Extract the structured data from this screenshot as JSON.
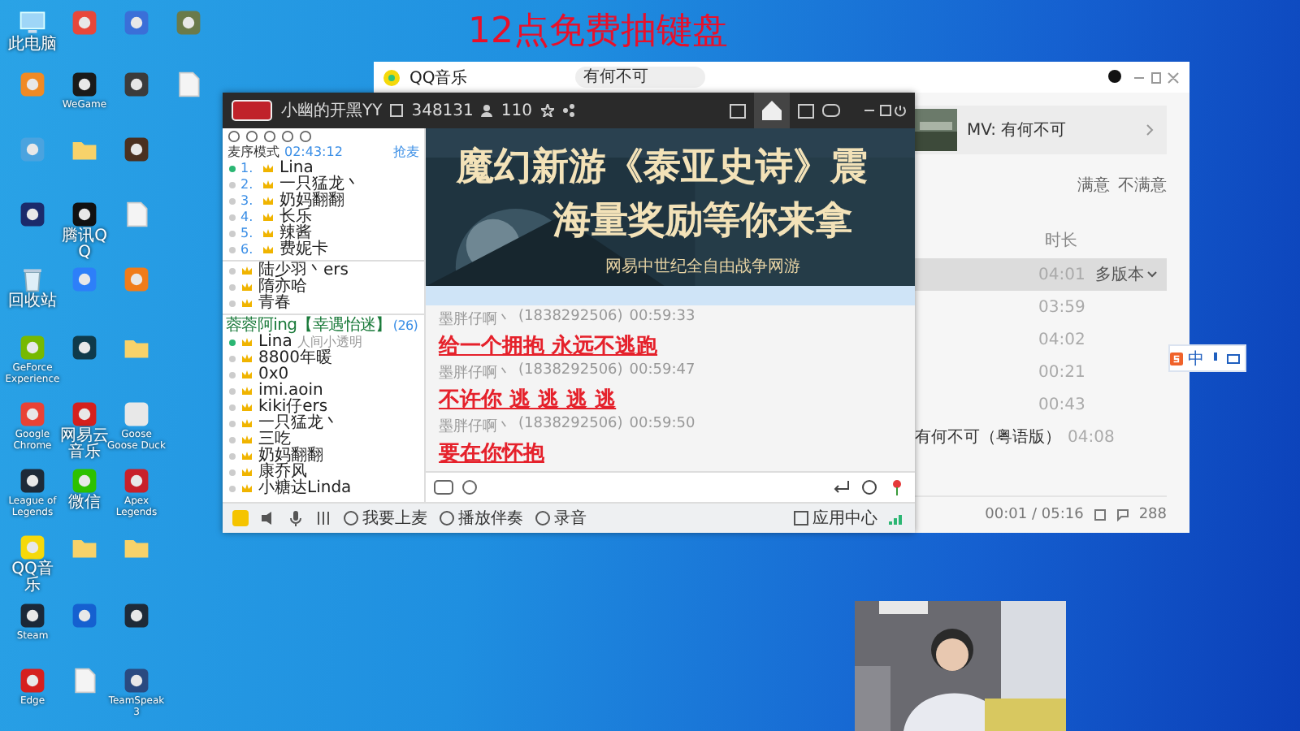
{
  "overlay_title": "12点免费抽键盘",
  "desktop_columns": [
    [
      {
        "kind": "pc",
        "label": "此电脑"
      },
      {
        "kind": "app",
        "color": "#f08a24"
      },
      {
        "kind": "app",
        "color": "#4aa3df"
      },
      {
        "kind": "app",
        "color": "#1b2a6b"
      },
      {
        "kind": "recycle",
        "label": "回收站"
      },
      {
        "kind": "app",
        "color": "#76b900",
        "label": "GeForce Experience"
      },
      {
        "kind": "app",
        "color": "#e94235",
        "label": "Google Chrome"
      },
      {
        "kind": "app",
        "color": "#1e2a38",
        "label": "League of Legends"
      },
      {
        "kind": "app",
        "color": "#f5d90a",
        "label": "QQ音乐"
      },
      {
        "kind": "app",
        "color": "#1b2838",
        "label": "Steam"
      },
      {
        "kind": "app",
        "color": "#d6201e",
        "label": "Edge"
      }
    ],
    [
      {
        "kind": "app",
        "color": "#e8473a"
      },
      {
        "kind": "app",
        "color": "#1a1a1a",
        "label": "WeGame"
      },
      {
        "kind": "folder"
      },
      {
        "kind": "app",
        "color": "#111111",
        "label": "腾讯QQ"
      },
      {
        "kind": "app",
        "color": "#2d7ff9"
      },
      {
        "kind": "app",
        "color": "#0f3a4a"
      },
      {
        "kind": "app",
        "color": "#d6201e",
        "label": "网易云音乐"
      },
      {
        "kind": "app",
        "color": "#2dc100",
        "label": "微信"
      },
      {
        "kind": "folder"
      },
      {
        "kind": "app",
        "color": "#1560d0"
      },
      {
        "kind": "file"
      }
    ],
    [
      {
        "kind": "app",
        "color": "#3a6fd8"
      },
      {
        "kind": "app",
        "color": "#3b3b3b"
      },
      {
        "kind": "app",
        "color": "#4a3020"
      },
      {
        "kind": "file"
      },
      {
        "kind": "app",
        "color": "#f07c1a"
      },
      {
        "kind": "folder"
      },
      {
        "kind": "app",
        "color": "#e8e8e8",
        "label": "Goose Goose Duck"
      },
      {
        "kind": "app",
        "color": "#c8202a",
        "label": "Apex Legends"
      },
      {
        "kind": "folder"
      },
      {
        "kind": "app",
        "color": "#1e2a38"
      },
      {
        "kind": "app",
        "color": "#2a4a80",
        "label": "TeamSpeak 3"
      }
    ],
    [
      {
        "kind": "app",
        "color": "#6a7a4a"
      },
      {
        "kind": "file"
      }
    ]
  ],
  "music": {
    "app_name": "QQ音乐",
    "search": "有何不可",
    "mv_title": "MV: 有何不可",
    "feedback": [
      "满意",
      "不满意"
    ],
    "duration_header": "时长",
    "rows": [
      {
        "time": "04:01",
        "versions": "多版本",
        "selected": true
      },
      {
        "time": "03:59",
        "selected": false
      },
      {
        "time": "04:02",
        "selected": false
      },
      {
        "time": "00:21",
        "selected": false
      },
      {
        "time": "00:43",
        "selected": false
      },
      {
        "title": "有何不可（粤语版）",
        "time": "04:08",
        "selected": false
      }
    ],
    "progress": "00:01 / 05:16",
    "comments": "288"
  },
  "yy": {
    "channel": "小幽的开黑YY",
    "channel_id": "348131",
    "online": "110",
    "mode": "麦序模式",
    "timer": "02:43:12",
    "grab_mic": "抢麦",
    "queue": [
      {
        "rank": "1.",
        "name": "Lina",
        "speaking": true
      },
      {
        "rank": "2.",
        "name": "一只猛龙丶",
        "speaking": false
      },
      {
        "rank": "3.",
        "name": "奶妈翻翻",
        "speaking": false
      },
      {
        "rank": "4.",
        "name": "长乐",
        "speaking": false
      },
      {
        "rank": "5.",
        "name": "辣酱",
        "speaking": false
      },
      {
        "rank": "6.",
        "name": "费妮卡",
        "speaking": false
      }
    ],
    "members_top": [
      {
        "name": "陆少羽丶ers"
      },
      {
        "name": "隋亦哈"
      },
      {
        "name": "青春"
      }
    ],
    "group": "蓉蓉阿ing【幸遇怡迷】",
    "group_count": "(26)",
    "members": [
      {
        "name": "Lina",
        "speaking": true,
        "status": "人间小透明"
      },
      {
        "name": "8800年暖",
        "speaking": false
      },
      {
        "name": "0x0",
        "speaking": false
      },
      {
        "name": "imi.aoin",
        "speaking": false
      },
      {
        "name": "kiki仔ers",
        "speaking": false
      },
      {
        "name": "一只猛龙丶",
        "speaking": false
      },
      {
        "name": "三吃",
        "speaking": false
      },
      {
        "name": "奶妈翻翻",
        "speaking": false
      },
      {
        "name": "康乔风",
        "speaking": false
      },
      {
        "name": "小糖达Linda",
        "speaking": false
      }
    ],
    "banner": [
      "魔幻新游《泰亚史诗》震",
      "海量奖励等你来拿",
      "网易中世纪全自由战争网游"
    ],
    "messages": [
      {
        "sender": "墨胖仔啊丶",
        "qq": "(1838292506)",
        "time": "00:59:33",
        "text": "给一个拥抱 永远不逃跑"
      },
      {
        "sender": "墨胖仔啊丶",
        "qq": "(1838292506)",
        "time": "00:59:47",
        "text": "不许你 逃 逃 逃 逃"
      },
      {
        "sender": "墨胖仔啊丶",
        "qq": "(1838292506)",
        "time": "00:59:50",
        "text": "要在你怀抱"
      }
    ],
    "bottom": [
      "我要上麦",
      "播放伴奏",
      "录音"
    ],
    "app_center": "应用中心"
  },
  "ime": {
    "mode": "中"
  }
}
